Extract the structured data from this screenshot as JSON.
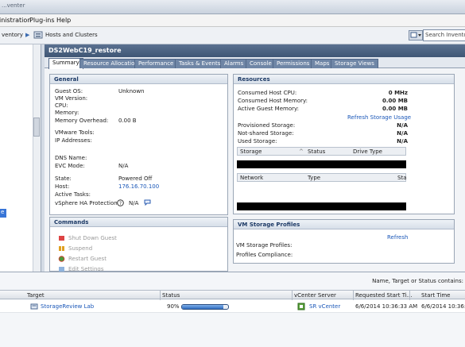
{
  "titlebar": {
    "title": "...venter"
  },
  "menu": [
    {
      "label": "inistration"
    },
    {
      "label": "Plug-ins",
      "underline": "P"
    },
    {
      "label": "Help",
      "underline": "H"
    }
  ],
  "nav": {
    "inventory": "ventory",
    "separator": "▶",
    "location": "Hosts and Clusters",
    "search_placeholder": "Search Inventor"
  },
  "left_tree": {
    "selected_fragment": "e"
  },
  "vm": {
    "name": "DS2WebC19_restore",
    "tabs": [
      "Summary",
      "Resource Allocation",
      "Performance",
      "Tasks & Events",
      "Alarms",
      "Console",
      "Permissions",
      "Maps",
      "Storage Views"
    ],
    "active_tab": "Summary"
  },
  "general": {
    "header": "General",
    "rows": [
      {
        "label": "Guest OS:",
        "value": "Unknown"
      },
      {
        "label": "VM Version:",
        "value": ""
      },
      {
        "label": "CPU:",
        "value": ""
      },
      {
        "label": "Memory:",
        "value": ""
      },
      {
        "label": "Memory Overhead:",
        "value": "0.00 B"
      },
      {
        "label": "VMware Tools:",
        "value": ""
      },
      {
        "label": "IP Addresses:",
        "value": ""
      },
      {
        "label": "DNS Name:",
        "value": ""
      },
      {
        "label": "EVC Mode:",
        "value": "N/A"
      },
      {
        "label": "State:",
        "value": "Powered Off"
      },
      {
        "label": "Host:",
        "value": "176.16.70.100"
      },
      {
        "label": "Active Tasks:",
        "value": ""
      },
      {
        "label": "vSphere HA Protection:",
        "value": "N/A"
      }
    ]
  },
  "resources": {
    "header": "Resources",
    "rows": [
      {
        "label": "Consumed Host CPU:",
        "value": "0 MHz"
      },
      {
        "label": "Consumed Host Memory:",
        "value": "0.00 MB"
      },
      {
        "label": "Active Guest Memory:",
        "value": "0.00 MB"
      }
    ],
    "refresh_link": "Refresh Storage Usage",
    "storage_rows": [
      {
        "label": "Provisioned Storage:",
        "value": "N/A"
      },
      {
        "label": "Not-shared Storage:",
        "value": "N/A"
      },
      {
        "label": "Used Storage:",
        "value": "N/A"
      }
    ],
    "storage_table": {
      "headers": [
        "Storage",
        "Status",
        "Drive Type"
      ]
    },
    "network_table": {
      "headers": [
        "Network",
        "Type",
        "Sta"
      ]
    }
  },
  "commands": {
    "header": "Commands",
    "items": [
      {
        "label": "Shut Down Guest",
        "icon": "shutdown-icon"
      },
      {
        "label": "Suspend",
        "icon": "suspend-icon"
      },
      {
        "label": "Restart Guest",
        "icon": "restart-icon"
      },
      {
        "label": "Edit Settings",
        "icon": "edit-icon"
      }
    ]
  },
  "storage_profiles": {
    "header": "VM Storage Profiles",
    "refresh": "Refresh",
    "rows": [
      {
        "label": "VM Storage Profiles:"
      },
      {
        "label": "Profiles Compliance:"
      }
    ]
  },
  "tasks": {
    "filter_text": "Name, Target or Status contains:",
    "headers": [
      "Target",
      "Status",
      "vCenter Server",
      "Requested Start Ti...",
      "Start Time"
    ],
    "rows": [
      {
        "target": "StorageReview Lab",
        "status_percent": 90,
        "status_text": "90%",
        "vcenter": "SR vCenter",
        "requested": "6/6/2014 10:36:33 AM",
        "start": "6/6/2014 10:36:33 AM"
      }
    ]
  },
  "colors": {
    "accent": "#1a57b8",
    "header_dark": "#3f5675",
    "tab_bg": "#6f86a6"
  }
}
